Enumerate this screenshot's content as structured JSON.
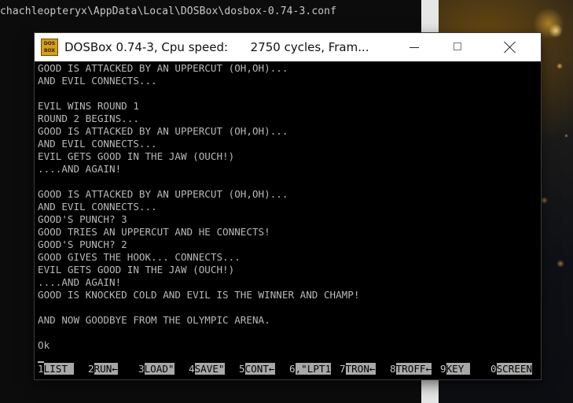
{
  "background_console": {
    "title": "chachleopteryx\\AppData\\Local\\DOSBox\\dosbox-0.74-3.conf"
  },
  "window": {
    "title": "DOSBox 0.74-3, Cpu speed:      2750 cycles, Fram...",
    "icon_text": "DOS BOX",
    "controls": [
      "minimize",
      "maximize",
      "close"
    ]
  },
  "screen": {
    "lines": [
      "GOOD IS ATTACKED BY AN UPPERCUT (OH,OH)...",
      "AND EVIL CONNECTS...",
      "",
      "EVIL WINS ROUND 1",
      "ROUND 2 BEGINS...",
      "GOOD IS ATTACKED BY AN UPPERCUT (OH,OH)...",
      "AND EVIL CONNECTS...",
      "EVIL GETS GOOD IN THE JAW (OUCH!)",
      "....AND AGAIN!",
      "",
      "GOOD IS ATTACKED BY AN UPPERCUT (OH,OH)...",
      "AND EVIL CONNECTS...",
      "GOOD'S PUNCH? 3",
      "GOOD TRIES AN UPPERCUT AND HE CONNECTS!",
      "GOOD'S PUNCH? 2",
      "GOOD GIVES THE HOOK... CONNECTS...",
      "EVIL GETS GOOD IN THE JAW (OUCH!)",
      "....AND AGAIN!",
      "GOOD IS KNOCKED COLD AND EVIL IS THE WINNER AND CHAMP!",
      "",
      "AND NOW GOODBYE FROM THE OLYMPIC ARENA.",
      "",
      "Ok"
    ],
    "function_keys": [
      {
        "num": "1",
        "label": "LIST "
      },
      {
        "num": "2",
        "label": "RUN←"
      },
      {
        "num": "3",
        "label": "LOAD\""
      },
      {
        "num": "4",
        "label": "SAVE\""
      },
      {
        "num": "5",
        "label": "CONT←"
      },
      {
        "num": "6",
        "label": ",\"LPT1"
      },
      {
        "num": "7",
        "label": "TRON←"
      },
      {
        "num": "8",
        "label": "TROFF←"
      },
      {
        "num": "9",
        "label": "KEY "
      },
      {
        "num": "0",
        "label": "SCREEN"
      }
    ]
  },
  "colors": {
    "screen_text": "#b9b9b9",
    "fkey_label_bg": "#a8a8a8",
    "titlebar_bg": "#ffffff"
  }
}
